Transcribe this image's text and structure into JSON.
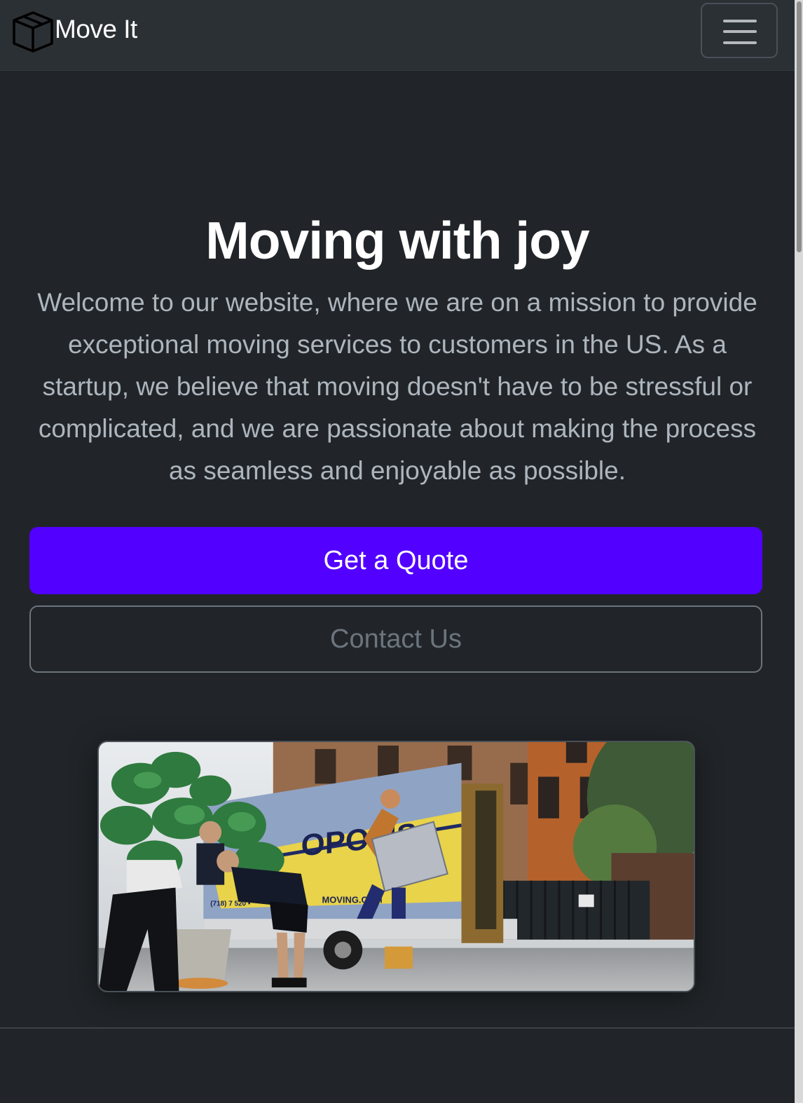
{
  "navbar": {
    "brand": "Move It",
    "brand_icon": "box-icon",
    "menu_icon": "hamburger-menu-icon"
  },
  "hero": {
    "title": "Moving with joy",
    "lead": "Welcome to our website, where we are on a mission to provide exceptional moving services to customers in the US. As a startup, we believe that moving doesn't have to be stressful or complicated, and we are passionate about making the process as seamless and enjoyable as possible.",
    "primary_button": "Get a Quote",
    "secondary_button": "Contact Us"
  },
  "photo": {
    "truck_text": "OPOLIS",
    "truck_url_text": "MOVING.COM",
    "truck_phone_text": "(718) 7   520 •"
  },
  "colors": {
    "background": "#212529",
    "navbar": "#2b3035",
    "primary": "#5200ff",
    "lead_text": "#adb5bd",
    "outline": "#6c757d"
  }
}
